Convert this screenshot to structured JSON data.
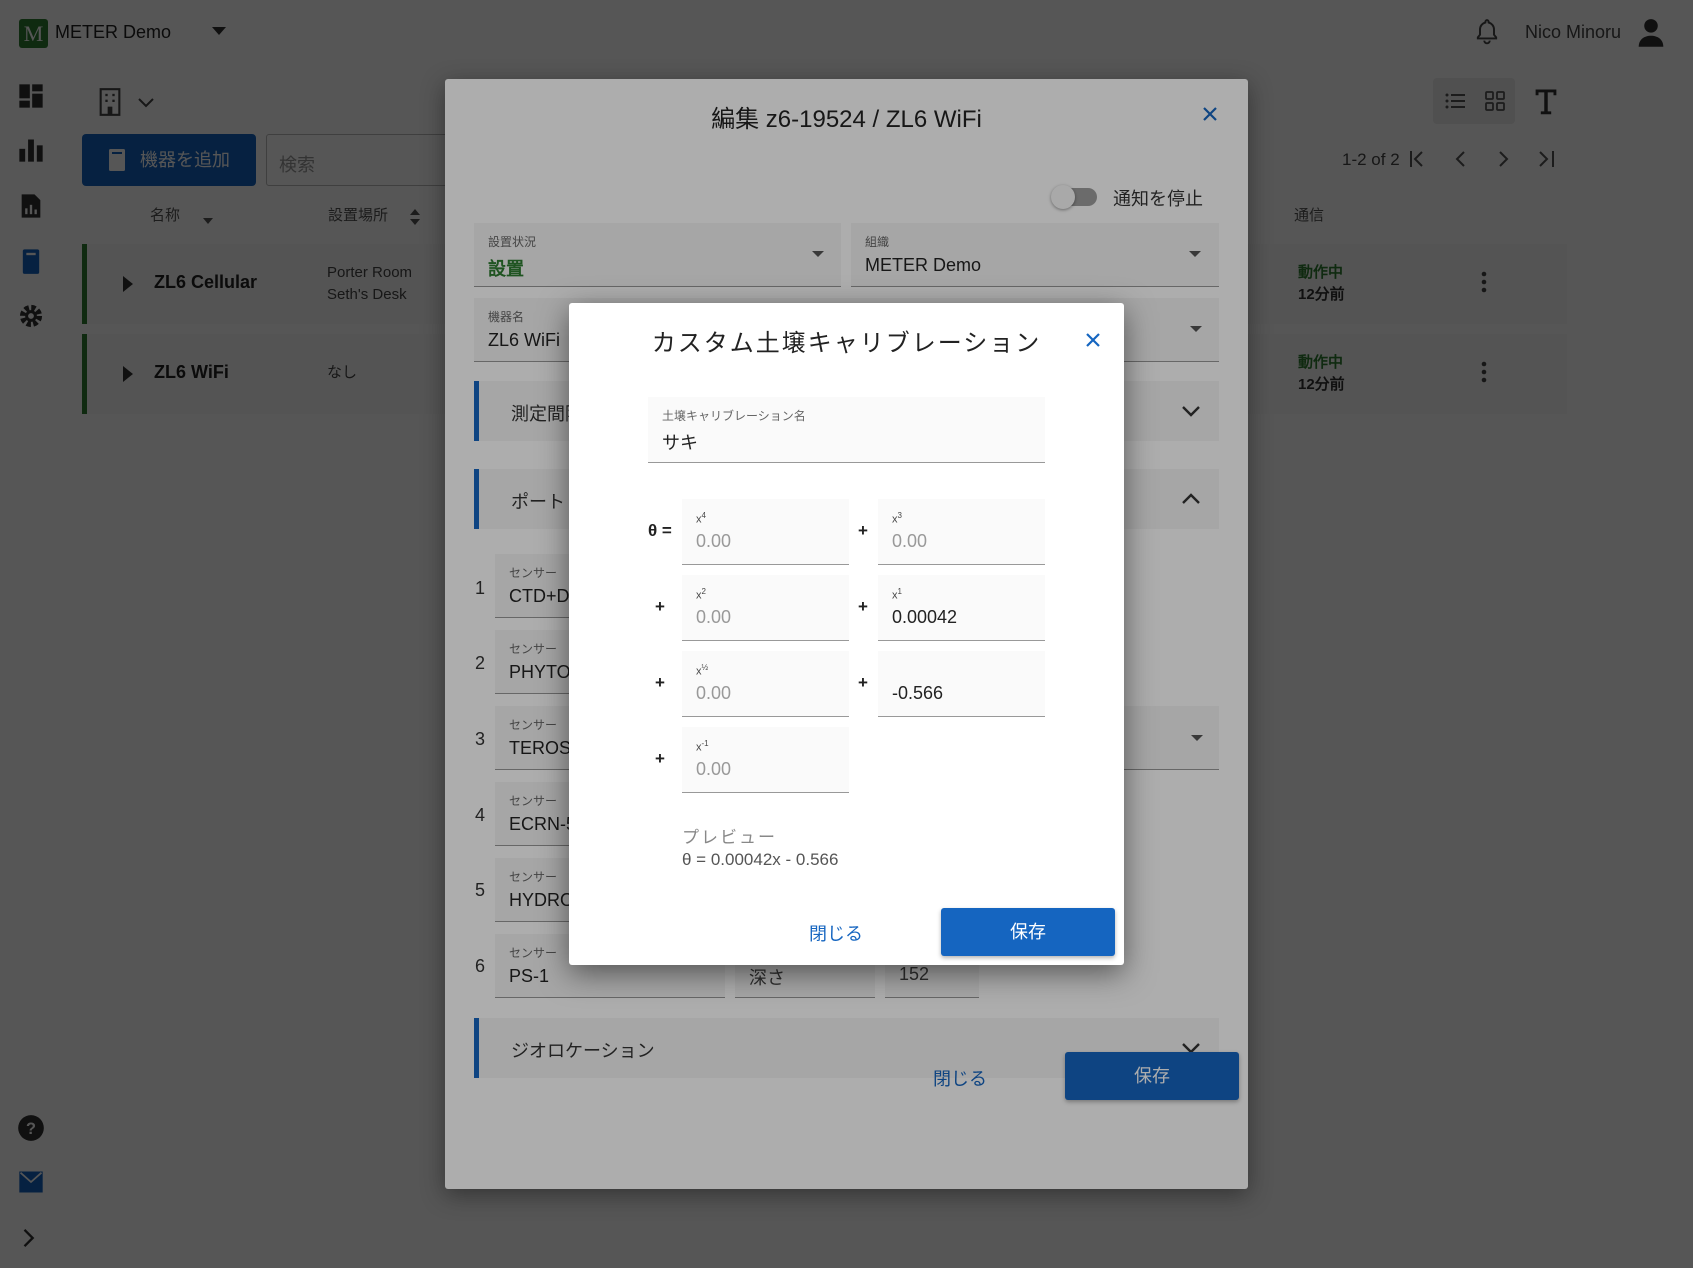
{
  "app": {
    "org_name": "METER Demo",
    "logo_letter": "M",
    "user_name": "Nico Minoru"
  },
  "toolbar": {
    "add_device_label": "機器を追加",
    "search_placeholder": "検索",
    "pagination": "1-2 of 2"
  },
  "table": {
    "headers": {
      "name": "名称",
      "location": "設置場所",
      "comm": "通信"
    },
    "rows": [
      {
        "name": "ZL6 Cellular",
        "location_line1": "Porter Room",
        "location_line2": "Seth's Desk",
        "status": "動作中",
        "ago": "12分前"
      },
      {
        "name": "ZL6 WiFi",
        "location_line1": "なし",
        "location_line2": "",
        "status": "動作中",
        "ago": "12分前"
      }
    ]
  },
  "edit_dialog": {
    "title": "編集 z6-19524 / ZL6 WiFi",
    "notify_toggle_label": "通知を停止",
    "install_status": {
      "label": "設置状況",
      "value": "設置"
    },
    "organization": {
      "label": "組織",
      "value": "METER Demo"
    },
    "device_name": {
      "label": "機器名",
      "value": "ZL6 WiFi"
    },
    "sections": {
      "measurement": "測定間隔",
      "ports": "ポート",
      "geolocation": "ジオロケーション"
    },
    "sensor_label": "センサー",
    "ports": [
      {
        "num": "1",
        "sensor": "CTD+DO"
      },
      {
        "num": "2",
        "sensor": "PHYTOS"
      },
      {
        "num": "3",
        "sensor": "TEROS"
      },
      {
        "num": "4",
        "sensor": "ECRN-5"
      },
      {
        "num": "5",
        "sensor": "HYDROS"
      },
      {
        "num": "6",
        "sensor": "PS-1"
      }
    ],
    "port6_depth_label": "深さ",
    "port6_depth_value": "152",
    "close_label": "閉じる",
    "save_label": "保存"
  },
  "calibration_dialog": {
    "title": "カスタム土壌キャリブレーション",
    "name_field": {
      "label": "土壌キャリブレーション名",
      "value": "サキ"
    },
    "theta_prefix": "θ =",
    "plus": "+",
    "terms": {
      "x4": {
        "base": "x",
        "exp": "4",
        "value": "0.00"
      },
      "x3": {
        "base": "x",
        "exp": "3",
        "value": "0.00"
      },
      "x2": {
        "base": "x",
        "exp": "2",
        "value": "0.00"
      },
      "x1": {
        "base": "x",
        "exp": "1",
        "value": "0.00042"
      },
      "xhalf": {
        "base": "x",
        "exp": "½",
        "value": "0.00"
      },
      "const": {
        "base": "",
        "exp": "",
        "value": "-0.566"
      },
      "xneg1": {
        "base": "x",
        "exp": "-1",
        "value": "0.00"
      }
    },
    "preview_label": "プレビュー",
    "preview_equation": "θ = 0.00042x - 0.566",
    "close_label": "閉じる",
    "save_label": "保存"
  },
  "colors": {
    "brand": "#1565c0",
    "status_green": "#2e7d32"
  }
}
